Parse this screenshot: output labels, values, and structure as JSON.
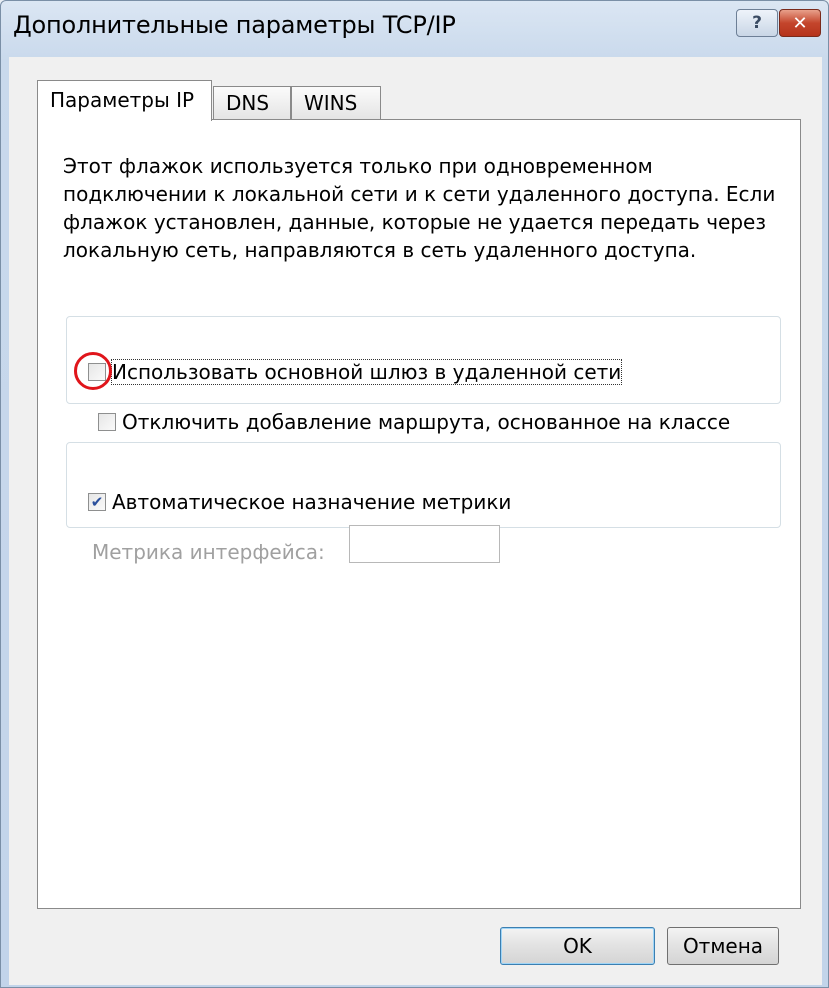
{
  "window": {
    "title": "Дополнительные параметры TCP/IP",
    "help_label": "?",
    "close_label": "✕"
  },
  "tabs": [
    {
      "label": "Параметры IP",
      "active": true
    },
    {
      "label": "DNS",
      "active": false
    },
    {
      "label": "WINS",
      "active": false
    }
  ],
  "description": "Этот флажок используется только при одновременном подключении к локальной сети и к сети удаленного доступа. Если флажок установлен, данные, которые не удается передать через локальную сеть, направляются в сеть удаленного доступа.",
  "options": {
    "use_default_gateway": {
      "label": "Использовать основной шлюз в удаленной сети",
      "checked": false
    },
    "disable_class_route": {
      "label": "Отключить добавление маршрута, основанное на классе",
      "checked": false
    },
    "auto_metric": {
      "label": "Автоматическое назначение метрики",
      "checked": true
    }
  },
  "metric": {
    "label": "Метрика интерфейса:",
    "value": ""
  },
  "buttons": {
    "ok": "OK",
    "cancel": "Отмена"
  },
  "colors": {
    "highlight_circle": "#e0151b",
    "checkmark": "#2a4f9c"
  }
}
